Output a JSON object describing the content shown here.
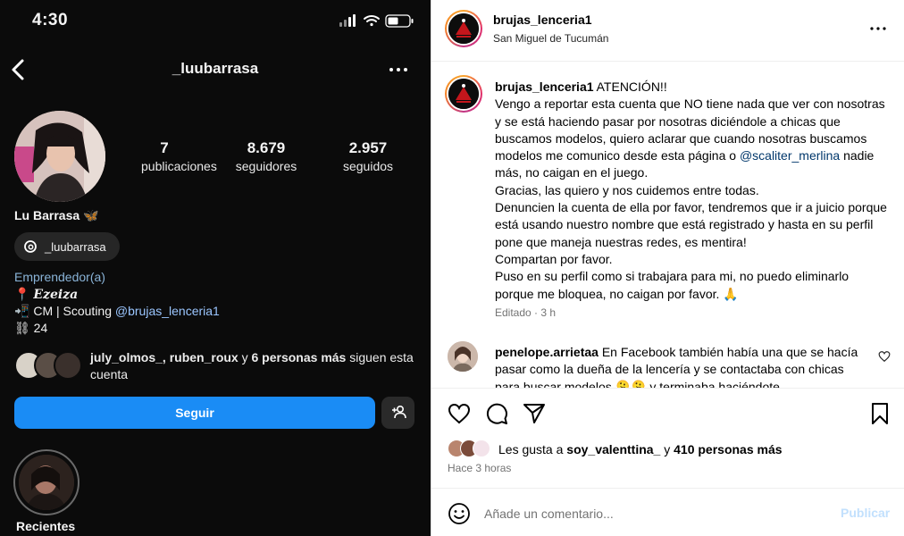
{
  "phone": {
    "status_time": "4:30",
    "profile": {
      "username": "_luubarrasa",
      "stats": [
        {
          "value": "7",
          "label": "publicaciones"
        },
        {
          "value": "8.679",
          "label": "seguidores"
        },
        {
          "value": "2.957",
          "label": "seguidos"
        }
      ],
      "display_name": "Lu Barrasa",
      "display_name_emoji": "🦋",
      "threads_handle": "_luubarrasa",
      "category": "Emprendedor(a)",
      "bio": {
        "location_emoji": "📍",
        "location": "Ezeiza",
        "line2_emoji": "📲",
        "line2_text": "CM | Scouting ",
        "line2_mention": "@brujas_lenceria1",
        "line3_emoji": "⛓",
        "line3_text": "24"
      },
      "followed_by": {
        "names": "july_olmos_, ruben_roux",
        "connector": " y ",
        "others": "6 personas más",
        "suffix": " siguen esta cuenta"
      },
      "follow_label": "Seguir",
      "highlight_label": "Recientes"
    }
  },
  "post": {
    "username": "brujas_lenceria1",
    "location": "San Miguel de Tucumán",
    "caption": {
      "username": "brujas_lenceria1",
      "part1": " ATENCIÓN!!\nVengo a reportar esta cuenta que NO tiene nada que ver con nosotras y se está haciendo pasar por nosotras diciéndole a chicas que buscamos modelos, quiero aclarar que cuando nosotras buscamos modelos me comunico desde esta página o ",
      "mention": "@scaliter_merlina",
      "part2": " nadie más, no caigan en el juego.\nGracias, las quiero y nos cuidemos entre todas.\nDenuncien la cuenta de ella por favor, tendremos que ir a juicio porque está usando nuestro nombre que está registrado y hasta en su perfil pone que maneja nuestras redes, es mentira!\nCompartan por favor.\nPuso en su perfil como si trabajara para mi, no puedo eliminarlo porque me bloquea, no caigan por favor. 🙏"
    },
    "edited": "Editado · 3 h",
    "comment": {
      "username": "penelope.arrietaa",
      "text": " En Facebook también había una que se hacía pasar como la dueña de la lencería y se contactaba con chicas para buscar modelos 🫠🫠 y terminaba haciéndote"
    },
    "likes": {
      "prefix": "Les gusta a ",
      "first": "soy_valenttina_",
      "connector": " y ",
      "others": "410 personas más"
    },
    "time_ago": "Hace 3 horas",
    "comment_placeholder": "Añade un comentario...",
    "publish_label": "Publicar"
  }
}
